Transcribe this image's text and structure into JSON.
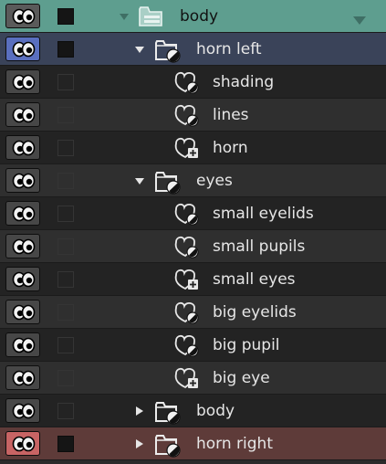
{
  "layers": [
    {
      "label": "body",
      "kind": "folder-group",
      "expander": "down",
      "depth": 0,
      "vis": "v-grey",
      "check": "solid",
      "bg": "bg-teal",
      "menu": true
    },
    {
      "label": "horn left",
      "kind": "folder",
      "expander": "down",
      "depth": 1,
      "vis": "v-blue",
      "check": "solid",
      "bg": "bg-blue"
    },
    {
      "label": "shading",
      "kind": "layer",
      "depth": 2,
      "vis": "v-dark",
      "check": "faint",
      "bg": "bg-dark"
    },
    {
      "label": "lines",
      "kind": "layer",
      "depth": 2,
      "vis": "v-dark",
      "check": "faint",
      "bg": "bg-mid"
    },
    {
      "label": "horn",
      "kind": "layer-plus",
      "depth": 2,
      "vis": "v-dark",
      "check": "faint",
      "bg": "bg-dark"
    },
    {
      "label": "eyes",
      "kind": "folder",
      "expander": "down",
      "depth": 1,
      "vis": "v-dark",
      "check": "faint",
      "bg": "bg-mid"
    },
    {
      "label": "small eyelids",
      "kind": "layer",
      "depth": 2,
      "vis": "v-dark",
      "check": "faint",
      "bg": "bg-dark"
    },
    {
      "label": "small pupils",
      "kind": "layer",
      "depth": 2,
      "vis": "v-dark",
      "check": "faint",
      "bg": "bg-mid"
    },
    {
      "label": "small eyes",
      "kind": "layer-plus",
      "depth": 2,
      "vis": "v-dark",
      "check": "faint",
      "bg": "bg-dark"
    },
    {
      "label": "big eyelids",
      "kind": "layer",
      "depth": 2,
      "vis": "v-dark",
      "check": "faint",
      "bg": "bg-mid"
    },
    {
      "label": "big pupil",
      "kind": "layer",
      "depth": 2,
      "vis": "v-dark",
      "check": "faint",
      "bg": "bg-dark"
    },
    {
      "label": "big eye",
      "kind": "layer-plus",
      "depth": 2,
      "vis": "v-dark",
      "check": "faint",
      "bg": "bg-mid"
    },
    {
      "label": "body",
      "kind": "folder",
      "expander": "right",
      "depth": 1,
      "vis": "v-dark",
      "check": "faint",
      "bg": "bg-dark"
    },
    {
      "label": "horn right",
      "kind": "folder",
      "expander": "right",
      "depth": 1,
      "vis": "v-red",
      "check": "solid",
      "bg": "bg-red"
    }
  ],
  "icons": {
    "visibility": "eye-icon",
    "folder": "folder-icon",
    "folder_group": "folder-group-icon",
    "layer": "layer-blob-icon",
    "layer_plus": "layer-blob-plus-icon",
    "expand_down": "triangle-down-icon",
    "expand_right": "triangle-right-icon",
    "menu": "dropdown-arrow-icon"
  },
  "colors": {
    "panel_bg": "#2b2b2b",
    "selected_row": "#5e9e8f",
    "blue_row": "#3a4359",
    "red_row": "#5e3b39",
    "eye_blue": "#5a6fbf",
    "eye_red": "#c86464"
  }
}
